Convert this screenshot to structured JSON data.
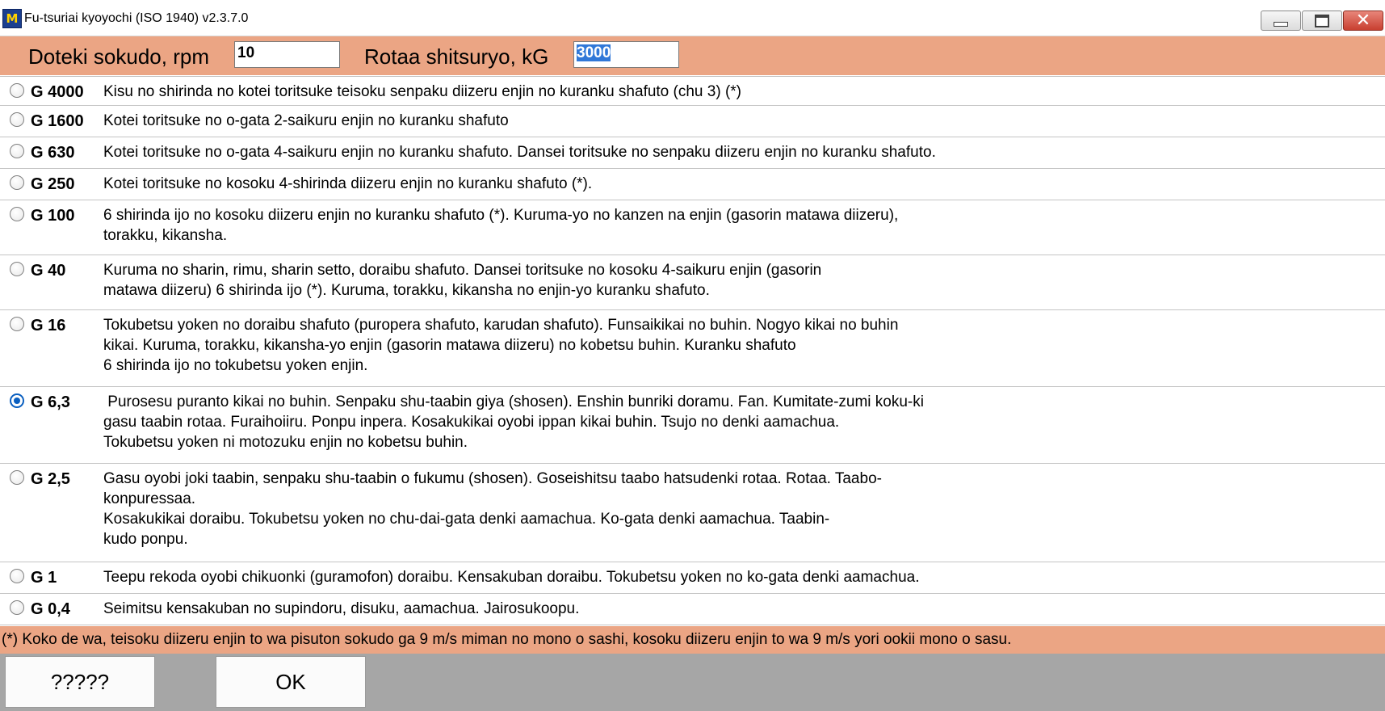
{
  "window": {
    "title": "Fu-tsuriai kyoyochi (ISO 1940) v2.3.7.0",
    "icon_text": "M"
  },
  "toolbar": {
    "speed_label": "Doteki sokudo, rpm",
    "speed_value": "10",
    "mass_label": "Rotaa shitsuryo, kG",
    "mass_value": "3000"
  },
  "grades": [
    {
      "grade": "G 4000",
      "checked": false,
      "lines": [
        "Kisu no shirinda no kotei toritsuke teisoku senpaku diizeru enjin no kuranku shafuto (chu 3) (*)"
      ]
    },
    {
      "grade": "G 1600",
      "checked": false,
      "lines": [
        "Kotei toritsuke no o-gata 2-saikuru enjin no kuranku shafuto"
      ]
    },
    {
      "grade": "G 630",
      "checked": false,
      "lines": [
        "Kotei toritsuke no o-gata 4-saikuru enjin no kuranku shafuto. Dansei toritsuke no senpaku diizeru enjin no kuranku shafuto."
      ]
    },
    {
      "grade": "G 250",
      "checked": false,
      "lines": [
        "Kotei toritsuke no kosoku 4-shirinda diizeru enjin no kuranku shafuto (*)."
      ]
    },
    {
      "grade": "G 100",
      "checked": false,
      "lines": [
        "6 shirinda ijo no kosoku diizeru enjin no kuranku shafuto (*). Kuruma-yo no kanzen na enjin (gasorin matawa diizeru),",
        "torakku, kikansha."
      ]
    },
    {
      "grade": "G 40",
      "checked": false,
      "lines": [
        "Kuruma no sharin, rimu, sharin setto, doraibu shafuto. Dansei toritsuke no kosoku 4-saikuru enjin (gasorin",
        "matawa diizeru) 6 shirinda ijo (*). Kuruma, torakku, kikansha no enjin-yo kuranku shafuto."
      ]
    },
    {
      "grade": "G 16",
      "checked": false,
      "lines": [
        "Tokubetsu yoken no doraibu shafuto (puropera shafuto, karudan shafuto). Funsaikikai no buhin. Nogyo kikai no buhin",
        "kikai. Kuruma, torakku, kikansha-yo enjin (gasorin matawa diizeru) no kobetsu buhin. Kuranku shafuto",
        "6 shirinda ijo no tokubetsu yoken enjin."
      ]
    },
    {
      "grade": "G 6,3",
      "checked": true,
      "lines": [
        " Purosesu puranto kikai no buhin. Senpaku shu-taabin giya (shosen). Enshin bunriki doramu. Fan. Kumitate-zumi koku-ki",
        "gasu taabin rotaa. Furaihoiiru. Ponpu inpera. Kosakukikai oyobi ippan kikai buhin. Tsujo no denki aamachua.",
        "Tokubetsu yoken ni motozuku enjin no kobetsu buhin."
      ]
    },
    {
      "grade": "G 2,5",
      "checked": false,
      "lines": [
        "Gasu oyobi joki taabin, senpaku shu-taabin o fukumu (shosen). Goseishitsu taabo hatsudenki rotaa. Rotaa. Taabo-",
        "konpuressaa.",
        "Kosakukikai doraibu. Tokubetsu yoken no chu-dai-gata denki aamachua. Ko-gata denki aamachua. Taabin-",
        "kudo ponpu."
      ]
    },
    {
      "grade": "G 1",
      "checked": false,
      "lines": [
        "Teepu rekoda oyobi chikuonki (guramofon) doraibu. Kensakuban doraibu. Tokubetsu yoken no ko-gata denki aamachua."
      ]
    },
    {
      "grade": "G 0,4",
      "checked": false,
      "lines": [
        "Seimitsu kensakuban no supindoru, disuku, aamachua. Jairosukoopu."
      ]
    }
  ],
  "footnote": "(*)  Koko de wa, teisoku diizeru enjin to wa pisuton sokudo ga 9 m/s miman no mono o sashi, kosoku diizeru enjin to wa 9 m/s yori ookii mono o sasu.",
  "buttons": {
    "help_label": "?????",
    "ok_label": "OK"
  }
}
